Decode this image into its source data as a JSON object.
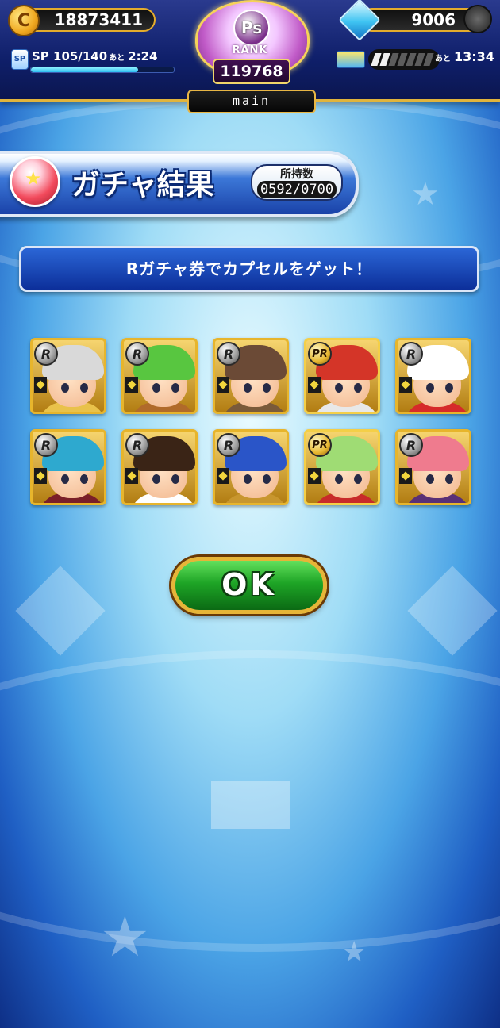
{
  "header": {
    "coins": "18873411",
    "coin_symbol": "C",
    "gems": "9006",
    "sp_label": "SP",
    "sp_value": "105/140",
    "sp_timer_prefix": "あと",
    "sp_timer": "2:24",
    "sp_fill_fraction": 0.75,
    "ticket_segments_total": 7,
    "ticket_segments_filled": 2,
    "ticket_timer_prefix": "あと",
    "ticket_timer": "13:34",
    "rank_badge": "Ps",
    "rank_label": "RANK",
    "rank_value": "119768",
    "mode_tab": "main"
  },
  "banner": {
    "title": "ガチャ結果",
    "owned_label": "所持数",
    "owned_value": "0592/0700"
  },
  "message": "Rガチャ券でカプセルをゲット！",
  "results": [
    {
      "rarity": "R",
      "hair": "#d9d9d9",
      "body": "#e9c24b"
    },
    {
      "rarity": "R",
      "hair": "#58c640",
      "body": "#b06a2a"
    },
    {
      "rarity": "R",
      "hair": "#6b4a36",
      "body": "#7a5a3a"
    },
    {
      "rarity": "PR",
      "hair": "#d43528",
      "body": "#e8e8e8"
    },
    {
      "rarity": "R",
      "hair": "#ffffff",
      "body": "#d62a2a"
    },
    {
      "rarity": "R",
      "hair": "#2ea9cf",
      "body": "#7a1f28"
    },
    {
      "rarity": "R",
      "hair": "#3a2416",
      "body": "#ffffff"
    },
    {
      "rarity": "R",
      "hair": "#2a55c8",
      "body": "#c8962e"
    },
    {
      "rarity": "PR",
      "hair": "#9fdc74",
      "body": "#c82a2a"
    },
    {
      "rarity": "R",
      "hair": "#ef7b8e",
      "body": "#5a3076"
    }
  ],
  "ok_button": "OK"
}
